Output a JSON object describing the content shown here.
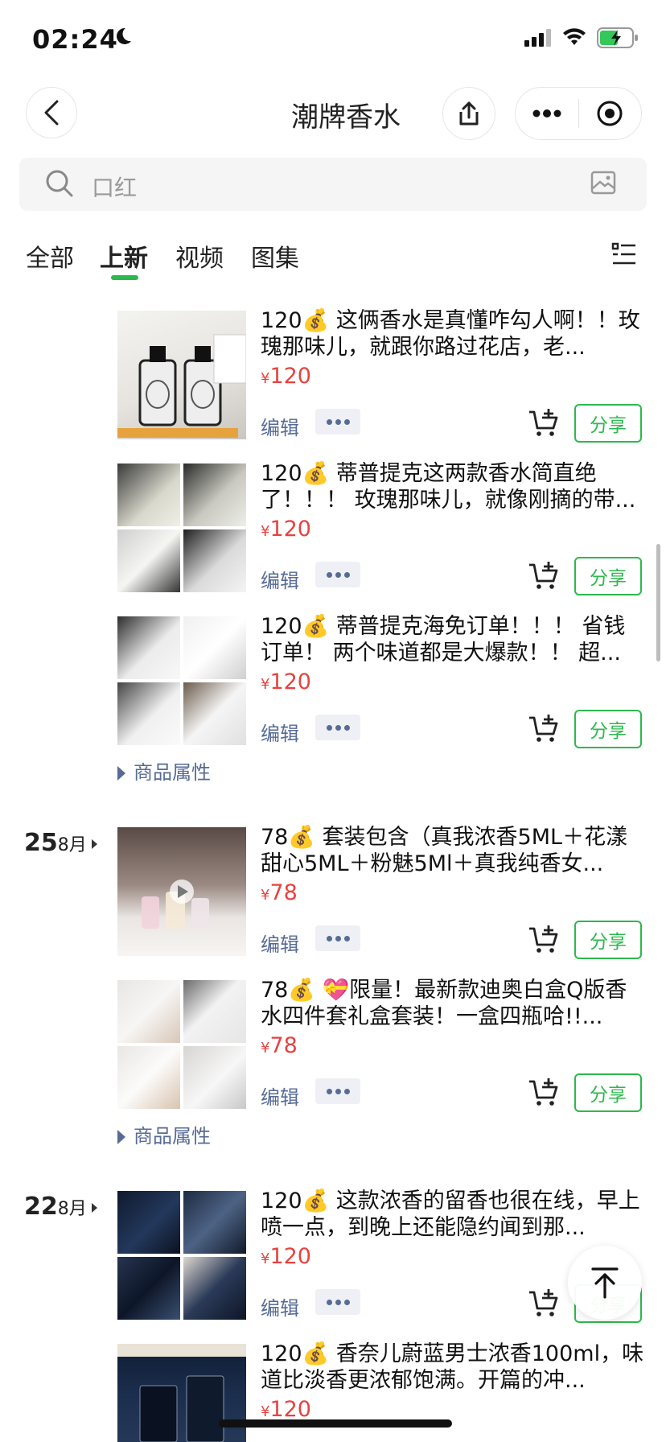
{
  "status": {
    "time": "02:24"
  },
  "nav": {
    "title": "潮牌香水"
  },
  "search": {
    "placeholder": "口红"
  },
  "tabs": [
    {
      "label": "全部"
    },
    {
      "label": "上新"
    },
    {
      "label": "视频"
    },
    {
      "label": "图集"
    }
  ],
  "active_tab": "上新",
  "common": {
    "edit": "编辑",
    "share": "分享",
    "attr": "商品属性",
    "currency": "¥"
  },
  "groups": [
    {
      "day": "",
      "month": "",
      "items": [
        {
          "text": "120💰 这俩香水是真懂咋勾人啊！！玫瑰那味儿，就跟你路过花店，老...",
          "price": "120"
        },
        {
          "text": "120💰 蒂普提克这两款香水简直绝了！！！ 玫瑰那味儿，就像刚摘的带...",
          "price": "120"
        },
        {
          "text": "120💰 蒂普提克海免订单！！！ 省钱订单！ 两个味道都是大爆款！！ 超...",
          "price": "120"
        }
      ]
    },
    {
      "day": "25",
      "month": "8月",
      "items": [
        {
          "text": "78💰 套装包含（真我浓香5ML＋花漾甜心5ML＋粉魅5Ml＋真我纯香女...",
          "price": "78"
        },
        {
          "text": "78💰 💝限量！最新款迪奥白盒Q版香水四件套礼盒套装！一盒四瓶哈!!...",
          "price": "78"
        }
      ]
    },
    {
      "day": "22",
      "month": "8月",
      "items": [
        {
          "text": "120💰 这款浓香的留香也很在线，早上喷一点，到晚上还能隐约闻到那...",
          "price": "120"
        },
        {
          "text": "120💰 香奈儿蔚蓝男士浓香100ml，味道比淡香更浓郁饱满。开篇的冲...",
          "price": "120"
        }
      ]
    }
  ],
  "colors": {
    "accent": "#2db84d",
    "price": "#e64340",
    "link": "#576b95"
  }
}
